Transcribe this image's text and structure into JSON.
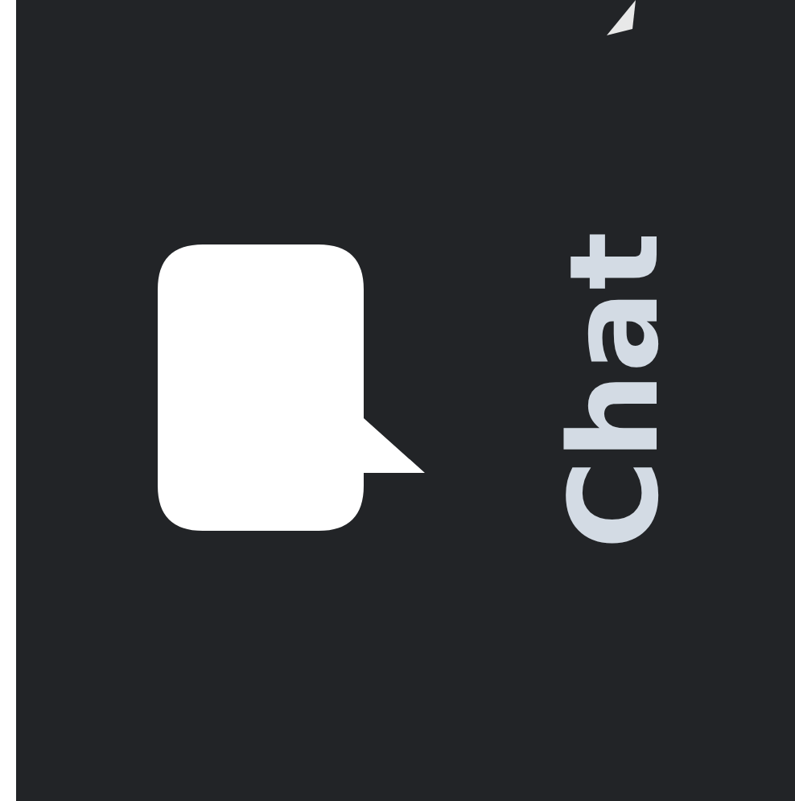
{
  "sidebar": {
    "items": [
      {
        "label": "Chat"
      }
    ]
  }
}
